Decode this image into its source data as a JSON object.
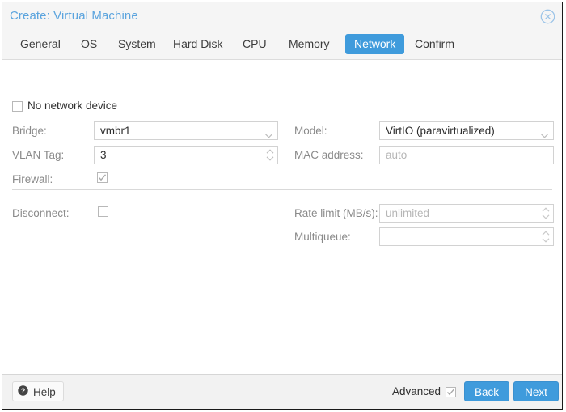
{
  "window": {
    "title": "Create: Virtual Machine",
    "close_icon": "close-circle-icon"
  },
  "tabs": [
    {
      "label": "General",
      "active": false
    },
    {
      "label": "OS",
      "active": false
    },
    {
      "label": "System",
      "active": false
    },
    {
      "label": "Hard Disk",
      "active": false
    },
    {
      "label": "CPU",
      "active": false
    },
    {
      "label": "Memory",
      "active": false
    },
    {
      "label": "Network",
      "active": true
    },
    {
      "label": "Confirm",
      "active": false
    }
  ],
  "form": {
    "no_network_device": {
      "label": "No network device",
      "checked": false
    },
    "bridge": {
      "label": "Bridge:",
      "value": "vmbr1",
      "type": "select"
    },
    "vlan_tag": {
      "label": "VLAN Tag:",
      "value": "3",
      "type": "spinner"
    },
    "firewall": {
      "label": "Firewall:",
      "checked": true
    },
    "model": {
      "label": "Model:",
      "value": "VirtIO (paravirtualized)",
      "type": "select"
    },
    "mac_address": {
      "label": "MAC address:",
      "value": "",
      "placeholder": "auto"
    },
    "disconnect": {
      "label": "Disconnect:",
      "checked": false
    },
    "rate_limit": {
      "label": "Rate limit (MB/s):",
      "value": "",
      "placeholder": "unlimited",
      "type": "spinner"
    },
    "multiqueue": {
      "label": "Multiqueue:",
      "value": "",
      "placeholder": "",
      "type": "spinner"
    }
  },
  "footer": {
    "help_label": "Help",
    "help_icon": "question-circle-icon",
    "advanced_label": "Advanced",
    "advanced_checked": true,
    "back_label": "Back",
    "next_label": "Next"
  },
  "colors": {
    "accent": "#3f9bdc",
    "title_text": "#5ba4de",
    "titlebar_bg": "#f5f5f5",
    "footer_bg": "#f2f2f2",
    "field_border": "#d2d2d2",
    "placeholder_text": "#b6b6b6"
  }
}
